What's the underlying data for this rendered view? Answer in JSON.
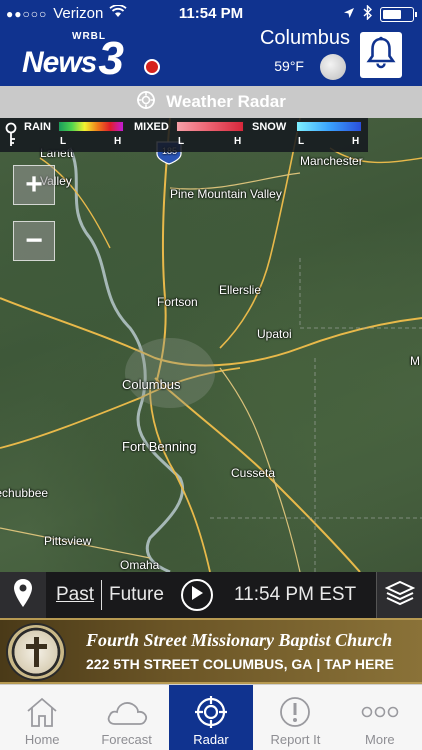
{
  "status_bar": {
    "signal": "●●○○○",
    "carrier": "Verizon",
    "time": "11:54 PM"
  },
  "header": {
    "logo_text": "News",
    "logo_number": "3",
    "logo_callsign": "WRBL",
    "city": "Columbus",
    "temperature": "59°F",
    "alert_icon": "bell-icon",
    "background_color": "#10338f"
  },
  "title_bar": {
    "icon": "crosshair-icon",
    "title": "Weather Radar"
  },
  "legend": {
    "groups": [
      {
        "label": "RAIN",
        "low": "L",
        "high": "H",
        "gradient": [
          "#1a9c5c",
          "#4fd34f",
          "#f2f230",
          "#f07f1a",
          "#e01d2a",
          "#c21cd8"
        ]
      },
      {
        "label": "MIXED",
        "low": "L",
        "high": "H",
        "gradient": [
          "#f7a0a8",
          "#ec6170",
          "#d8273b"
        ]
      },
      {
        "label": "SNOW",
        "low": "L",
        "high": "H",
        "gradient": [
          "#7ef0ff",
          "#3aa3ff",
          "#2a4fdc"
        ]
      }
    ]
  },
  "map": {
    "zoom_in_label": "+",
    "zoom_out_label": "−",
    "places": [
      {
        "name": "Lanett"
      },
      {
        "name": "Valley"
      },
      {
        "name": "Manchester"
      },
      {
        "name": "Pine Mountain Valley"
      },
      {
        "name": "Ellerslie"
      },
      {
        "name": "Fortson"
      },
      {
        "name": "Upatoi"
      },
      {
        "name": "Columbus"
      },
      {
        "name": "Fort Benning"
      },
      {
        "name": "Cusseta"
      },
      {
        "name": "Hatchechubbee"
      },
      {
        "name": "Pittsview"
      },
      {
        "name": "Omaha"
      },
      {
        "name": "M"
      },
      {
        "name": "185"
      }
    ]
  },
  "timebar": {
    "past_label": "Past",
    "future_label": "Future",
    "time_label": "11:54 PM EST"
  },
  "ad": {
    "title": "Fourth Street Missionary Baptist Church",
    "address": "222 5TH STREET COLUMBUS, GA",
    "separator": "|",
    "cta": "TAP HERE"
  },
  "tabs": [
    {
      "label": "Home",
      "icon": "home-icon",
      "active": false
    },
    {
      "label": "Forecast",
      "icon": "cloud-icon",
      "active": false
    },
    {
      "label": "Radar",
      "icon": "radar-icon",
      "active": true
    },
    {
      "label": "Report It",
      "icon": "alert-icon",
      "active": false
    },
    {
      "label": "More",
      "icon": "more-icon",
      "active": false
    }
  ]
}
